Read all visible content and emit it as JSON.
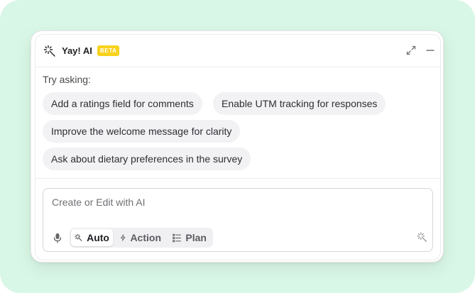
{
  "app": {
    "title": "Yay! AI",
    "badge": "BETA",
    "icons": {
      "logo": "magic-wand-icon",
      "expand": "expand-arrows-icon",
      "minimize": "minus-icon",
      "mic": "microphone-icon",
      "auto": "magic-wand-icon",
      "action": "lightning-icon",
      "plan": "list-icon",
      "submit": "magic-wand-icon"
    },
    "colors": {
      "background": "#d9f7e6",
      "badge": "#f8d21d"
    }
  },
  "suggestions": {
    "label": "Try asking:",
    "items": [
      "Add a ratings field for comments",
      "Enable UTM tracking for responses",
      "Improve the welcome message for clarity",
      "Ask about dietary preferences in the survey"
    ]
  },
  "composer": {
    "placeholder": "Create or Edit with AI",
    "value": "",
    "modes": [
      {
        "label": "Auto",
        "active": true
      },
      {
        "label": "Action",
        "active": false
      },
      {
        "label": "Plan",
        "active": false
      }
    ]
  }
}
